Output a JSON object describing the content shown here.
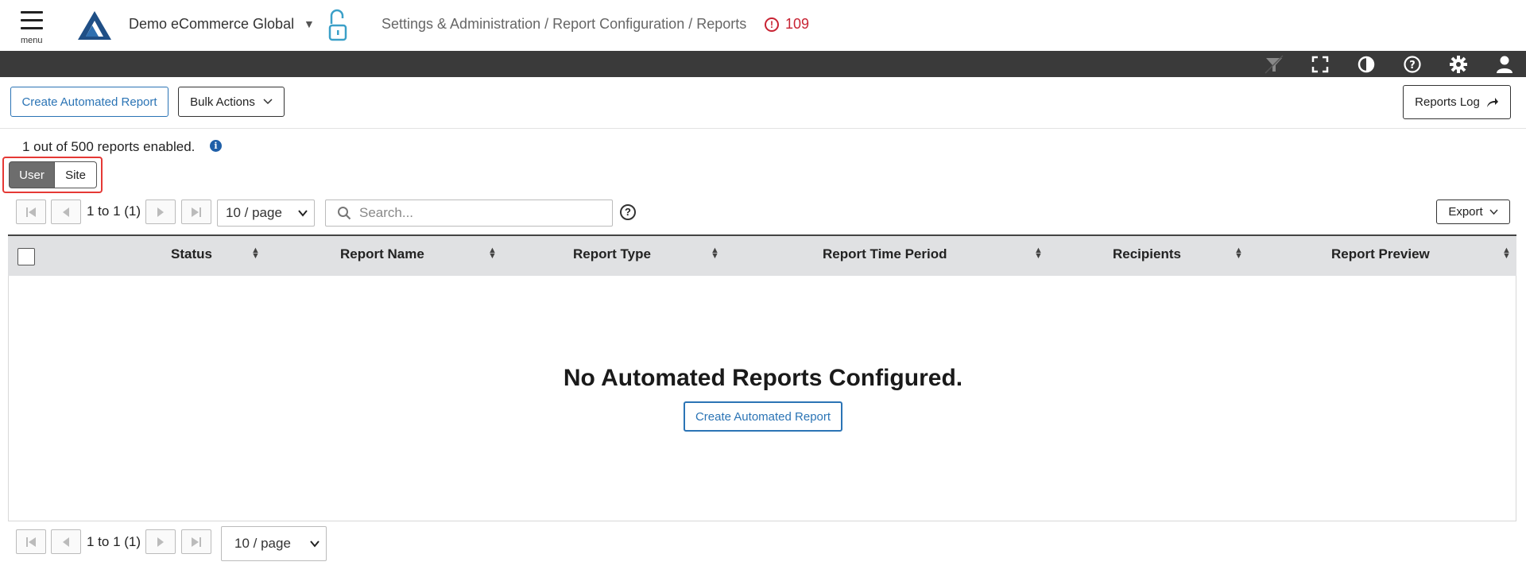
{
  "header": {
    "menu_label": "menu",
    "company": "Demo eCommerce Global",
    "breadcrumb": "Settings & Administration / Report Configuration / Reports",
    "alert_count": "109"
  },
  "toolbar": {
    "icons": [
      "filter-icon",
      "fullscreen-icon",
      "contrast-icon",
      "help-icon",
      "gear-icon",
      "user-icon"
    ]
  },
  "actions": {
    "create_label": "Create Automated Report",
    "bulk_label": "Bulk Actions",
    "reports_log_label": "Reports Log"
  },
  "summary": {
    "enabled_text": "1 out of 500 reports enabled."
  },
  "scope_toggle": {
    "user_label": "User",
    "site_label": "Site",
    "selected": "User"
  },
  "pager": {
    "range_text": "1 to 1 (1)",
    "page_size": "10 / page"
  },
  "search": {
    "placeholder": "Search..."
  },
  "export_label": "Export",
  "table": {
    "columns": [
      "Status",
      "Report Name",
      "Report Type",
      "Report Time Period",
      "Recipients",
      "Report Preview"
    ]
  },
  "empty_state": {
    "title": "No Automated Reports Configured.",
    "button_label": "Create Automated Report"
  },
  "colors": {
    "accent_blue": "#2b74b5",
    "toolbar_dark": "#3a3a3a",
    "alert_red": "#c82333",
    "highlight_red": "#e53935"
  }
}
